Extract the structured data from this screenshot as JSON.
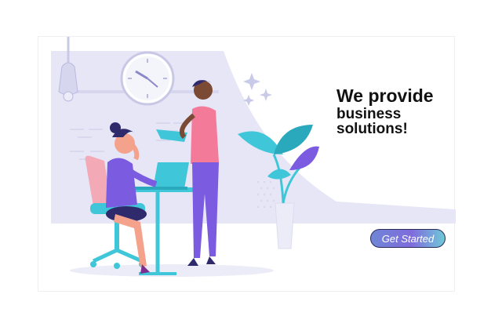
{
  "hero": {
    "headline_line1": "We provide",
    "headline_line2": "business solutions!",
    "cta_label": "Get Started"
  },
  "colors": {
    "background_panel": "#e6e6f6",
    "accent_purple": "#7b5ce0",
    "accent_teal": "#3fc7d9",
    "accent_pink": "#f47a9a",
    "cta_gradient_start": "#6f86d6",
    "cta_gradient_end": "#6ec9d8"
  },
  "illustration": {
    "icons": [
      "wall-clock-icon",
      "pendant-lamp-icon",
      "sparkle-icon",
      "office-chair-icon",
      "laptop-icon",
      "potted-plant-icon",
      "desk-icon"
    ]
  }
}
